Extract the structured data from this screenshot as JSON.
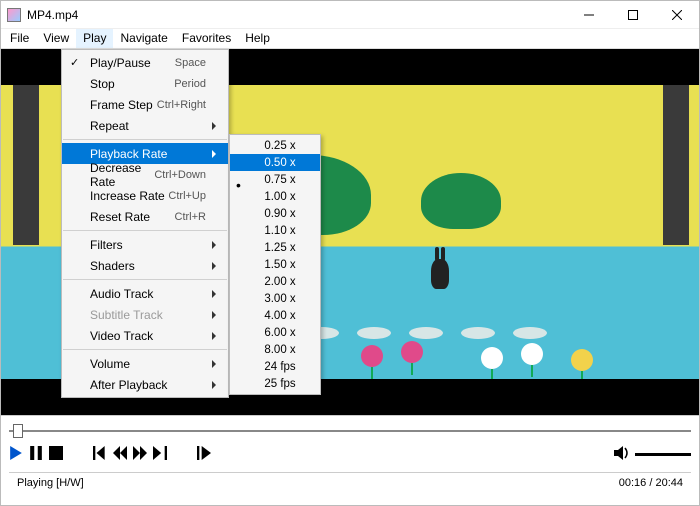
{
  "window": {
    "title": "MP4.mp4"
  },
  "menubar": [
    "File",
    "View",
    "Play",
    "Navigate",
    "Favorites",
    "Help"
  ],
  "menubar_open_index": 2,
  "play_menu": {
    "groups": [
      [
        {
          "label": "Play/Pause",
          "shortcut": "Space",
          "check": true
        },
        {
          "label": "Stop",
          "shortcut": "Period"
        },
        {
          "label": "Frame Step",
          "shortcut": "Ctrl+Right"
        },
        {
          "label": "Repeat",
          "arrow": true
        }
      ],
      [
        {
          "label": "Playback Rate",
          "arrow": true,
          "highlight": true
        },
        {
          "label": "Decrease Rate",
          "shortcut": "Ctrl+Down"
        },
        {
          "label": "Increase Rate",
          "shortcut": "Ctrl+Up"
        },
        {
          "label": "Reset Rate",
          "shortcut": "Ctrl+R"
        }
      ],
      [
        {
          "label": "Filters",
          "arrow": true
        },
        {
          "label": "Shaders",
          "arrow": true
        }
      ],
      [
        {
          "label": "Audio Track",
          "arrow": true
        },
        {
          "label": "Subtitle Track",
          "arrow": true,
          "disabled": true
        },
        {
          "label": "Video Track",
          "arrow": true
        }
      ],
      [
        {
          "label": "Volume",
          "arrow": true
        },
        {
          "label": "After Playback",
          "arrow": true
        }
      ]
    ]
  },
  "rate_submenu": [
    {
      "label": "0.25 x"
    },
    {
      "label": "0.50 x",
      "highlight": true
    },
    {
      "label": "0.75 x",
      "dot": true
    },
    {
      "label": "1.00 x"
    },
    {
      "label": "0.90 x"
    },
    {
      "label": "1.10 x"
    },
    {
      "label": "1.25 x"
    },
    {
      "label": "1.50 x"
    },
    {
      "label": "2.00 x"
    },
    {
      "label": "3.00 x"
    },
    {
      "label": "4.00 x"
    },
    {
      "label": "6.00 x"
    },
    {
      "label": "8.00 x"
    },
    {
      "label": "24 fps"
    },
    {
      "label": "25 fps"
    }
  ],
  "status": {
    "left": "Playing [H/W]",
    "right": "00:16 / 20:44"
  }
}
